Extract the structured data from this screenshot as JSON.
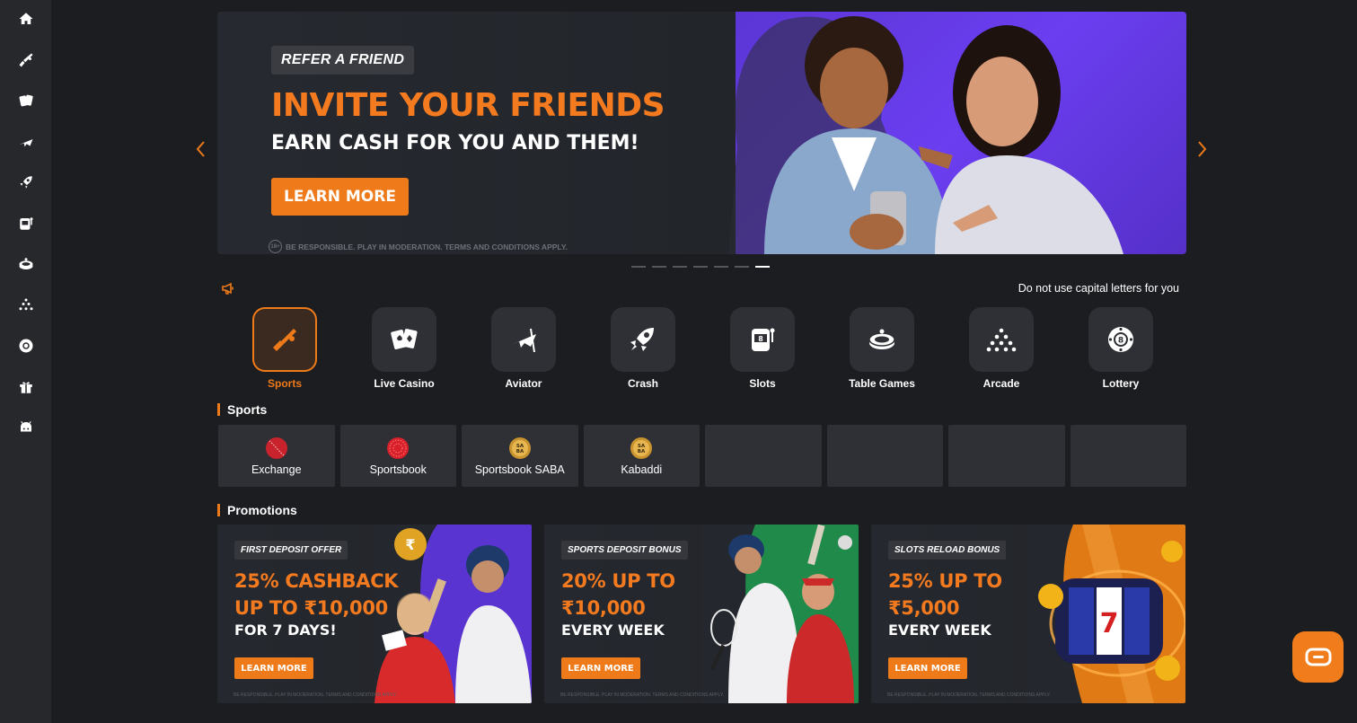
{
  "sidebar": {
    "icons": [
      "home-icon",
      "sports-icon",
      "live-casino-icon",
      "aviator-icon",
      "crash-icon",
      "slots-icon",
      "table-games-icon",
      "arcade-icon",
      "lottery-icon",
      "gift-icon",
      "android-icon"
    ]
  },
  "hero": {
    "tag": "REFER A FRIEND",
    "title": "INVITE YOUR FRIENDS",
    "subtitle": "EARN CASH FOR YOU AND THEM!",
    "button": "LEARN MORE",
    "disclaimer": "BE RESPONSIBLE. PLAY IN MODERATION. TERMS AND CONDITIONS APPLY.",
    "age_badge": "18+",
    "slide_count": 7,
    "active_slide": 7
  },
  "announcement": {
    "text": "Do not use capital letters for you"
  },
  "categories": [
    {
      "label": "Sports",
      "icon": "sports-icon",
      "active": true
    },
    {
      "label": "Live Casino",
      "icon": "cards-icon",
      "active": false
    },
    {
      "label": "Aviator",
      "icon": "plane-icon",
      "active": false
    },
    {
      "label": "Crash",
      "icon": "rocket-icon",
      "active": false
    },
    {
      "label": "Slots",
      "icon": "slot-machine-icon",
      "active": false
    },
    {
      "label": "Table Games",
      "icon": "roulette-icon",
      "active": false
    },
    {
      "label": "Arcade",
      "icon": "arcade-icon",
      "active": false
    },
    {
      "label": "Lottery",
      "icon": "lottery-ball-icon",
      "active": false
    }
  ],
  "sports": {
    "title": "Sports",
    "tiles": [
      {
        "name": "Exchange",
        "logo": "cricket-ball-logo"
      },
      {
        "name": "Sportsbook",
        "logo": "sportsbook-logo"
      },
      {
        "name": "Sportsbook SABA",
        "logo": "saba-logo"
      },
      {
        "name": "Kabaddi",
        "logo": "saba-logo"
      },
      {
        "name": "",
        "logo": ""
      },
      {
        "name": "",
        "logo": ""
      },
      {
        "name": "",
        "logo": ""
      },
      {
        "name": "",
        "logo": ""
      }
    ]
  },
  "promotions": {
    "title": "Promotions",
    "items": [
      {
        "tag": "FIRST DEPOSIT OFFER",
        "line1": "25% CASHBACK",
        "line2": "UP TO ₹10,000",
        "line3": "FOR 7 DAYS!",
        "button": "LEARN MORE",
        "disclaimer": "BE RESPONSIBLE. PLAY IN MODERATION. TERMS AND CONDITIONS APPLY."
      },
      {
        "tag": "SPORTS DEPOSIT BONUS",
        "line1": "20% UP TO",
        "line2": "₹10,000",
        "line3": "EVERY WEEK",
        "button": "LEARN MORE",
        "disclaimer": "BE RESPONSIBLE. PLAY IN MODERATION. TERMS AND CONDITIONS APPLY."
      },
      {
        "tag": "SLOTS RELOAD BONUS",
        "line1": "25% UP TO",
        "line2": "₹5,000",
        "line3": "EVERY WEEK",
        "button": "LEARN MORE",
        "disclaimer": "BE RESPONSIBLE. PLAY IN MODERATION. TERMS AND CONDITIONS APPLY."
      }
    ]
  },
  "colors": {
    "accent": "#ef7a1a",
    "background": "#1c1d21",
    "sidebar": "#27282c",
    "tile": "#2e3035"
  }
}
